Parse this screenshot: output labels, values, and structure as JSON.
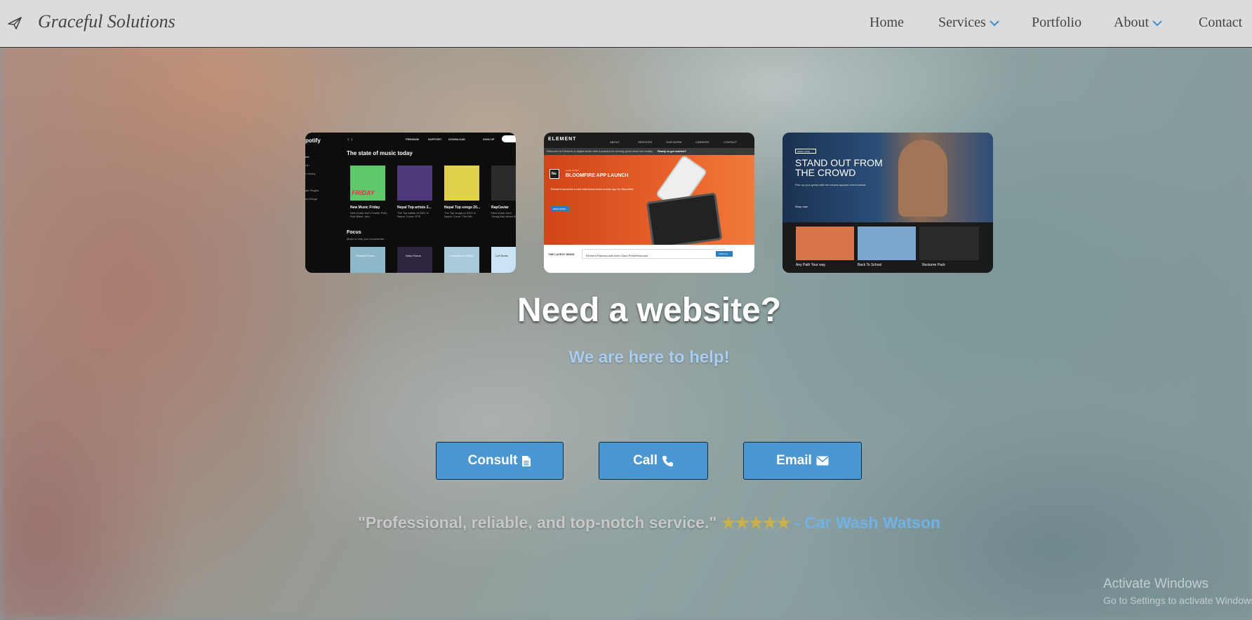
{
  "navbar": {
    "brand": "Graceful Solutions",
    "brand_icon": "paper-plane-icon",
    "items": [
      {
        "label": "Home"
      },
      {
        "label": "Services",
        "has_dropdown": true
      },
      {
        "label": "Portfolio"
      },
      {
        "label": "About",
        "has_dropdown": true
      },
      {
        "label": "Contact"
      }
    ]
  },
  "portfolio": {
    "spotify": {
      "logo": "potify",
      "nav": [
        "PREMIUM",
        "SUPPORT",
        "DOWNLOAD",
        "SIGN UP"
      ],
      "heading": "The state of music today",
      "cards": [
        {
          "title": "New Music Friday",
          "sub": "New music from Charlie Puth, Rod Wave, tom..."
        },
        {
          "title": "Nepal Top artists 2...",
          "sub": "The Top artists of 2021 in Nepal. Cover: ETE"
        },
        {
          "title": "Nepal Top songs 20...",
          "sub": "The Top songs of 2021 in Nepal. Cover: The Kill..."
        },
        {
          "title": "RapCaviar",
          "sub": "New music from Young Boy Never B..."
        }
      ],
      "card_overlay": "FRIDAY",
      "sidebar": [
        "me",
        "rch",
        "r Library",
        "ate Playlist",
        "ed Songs"
      ],
      "focus": "Focus",
      "focus_sub": "Music to help you concentrate.",
      "focus_cards": [
        "Peaceful Piano",
        "Deep Focus",
        "Instrumental Study",
        "Lofi Beats"
      ]
    },
    "element": {
      "logo": "ELEMENT",
      "nav": [
        "ABOUT",
        "SERVICES",
        "OUR WORK",
        "CAREERS",
        "CONTACT"
      ],
      "banner": "Welcome to Element. A digital studio with a passion for turning great ideas into reality.",
      "banner_cta": "Ready to get started?",
      "badge": "Nu",
      "eyebrow": "CASE STUDY",
      "heading": "BLOOMFIRE APP LAUNCH",
      "body": "Element launches a new interactive team mobile app for Bloomfire.",
      "button": "READ MORE",
      "news_label": "THE LATEST NEWS",
      "news_text": "Element Partners with New Client PrimeResource",
      "news_button": "VIEW ALL"
    },
    "crowd": {
      "tag": "FIRST LOOK",
      "heading": "STAND OUT FROM THE CROWD",
      "body": "Pick up your game with the newest apparel and footwear.",
      "link": "Shop now",
      "items": [
        "Any Path Your way",
        "Back To School",
        "Nocturne Pack"
      ]
    }
  },
  "hero": {
    "title": "Need a website?",
    "subtitle": "We are here to help!"
  },
  "buttons": {
    "consult": "Consult",
    "call": "Call",
    "email": "Email"
  },
  "testimonial": {
    "quote": "\"Professional, reliable, and top-notch service.\"",
    "stars": "★★★★★",
    "dash": " - ",
    "author": "Car Wash Watson"
  },
  "watermark": {
    "line1": "Activate Windows",
    "line2": "Go to Settings to activate Windows."
  },
  "colors": {
    "button_bg": "#4a97d1",
    "accent_blue": "#6fb2e8",
    "navbar_bg": "#dcdcdc",
    "star_gold": "#c9b04a"
  }
}
